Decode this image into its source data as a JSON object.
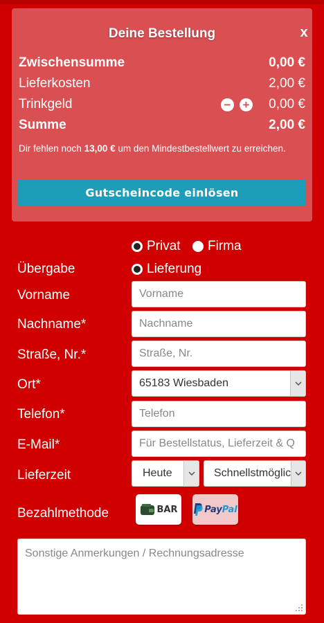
{
  "order": {
    "title": "Deine Bestellung",
    "close_label": "x",
    "subtotal": {
      "label": "Zwischensumme",
      "value": "0,00 €"
    },
    "delivery": {
      "label": "Lieferkosten",
      "value": "2,00 €"
    },
    "tip": {
      "label": "Trinkgeld",
      "minus": "−",
      "plus": "+",
      "value": "0,00 €"
    },
    "total": {
      "label": "Summe",
      "value": "2,00 €"
    },
    "hint_prefix": "Dir fehlen noch",
    "hint_amount": "13,00 €",
    "hint_suffix": "um den Mindestbestellwert zu erreichen.",
    "voucher_button": "Gutscheincode einlösen"
  },
  "form": {
    "customer_type": {
      "option_private": "Privat",
      "option_company": "Firma",
      "selected": "Privat"
    },
    "handover": {
      "label": "Übergabe",
      "option_delivery": "Lieferung"
    },
    "first_name": {
      "label": "Vorname",
      "placeholder": "Vorname"
    },
    "last_name": {
      "label": "Nachname*",
      "placeholder": "Nachname"
    },
    "street": {
      "label": "Straße, Nr.*",
      "placeholder": "Straße, Nr."
    },
    "city": {
      "label": "Ort*",
      "value": "65183 Wiesbaden"
    },
    "phone": {
      "label": "Telefon*",
      "placeholder": "Telefon"
    },
    "email": {
      "label": "E-Mail*",
      "placeholder": "Für Bestellstatus, Lieferzeit & Q"
    },
    "delivery_time": {
      "label": "Lieferzeit",
      "day_value": "Heute",
      "time_value": "Schnellstmöglich"
    },
    "payment": {
      "label": "Bezahlmethode",
      "cash_label": "BAR",
      "paypal_label_1": "Pay",
      "paypal_label_2": "Pal"
    },
    "notes": {
      "placeholder": "Sonstige Anmerkungen / Rechnungsadresse"
    }
  },
  "colors": {
    "page": "#d10000",
    "panel": "#d94f52",
    "voucher": "#1c9db8"
  }
}
